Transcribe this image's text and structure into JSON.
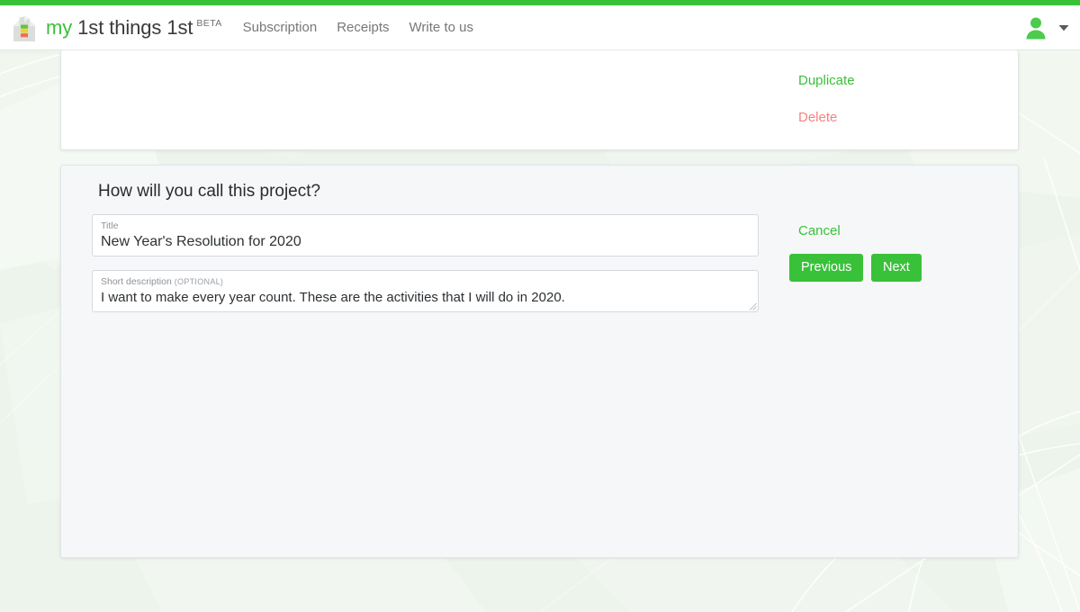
{
  "theme": {
    "brand_green": "#3ac13a",
    "delete_red": "#f8827f",
    "page_bg": "#ecf4ec",
    "card_white": "#ffffff",
    "card_gray": "#f6f7f9"
  },
  "header": {
    "logo_icon": "house-energy-logo-icon",
    "brand_my": "my",
    "brand_rest": "1st things 1st",
    "brand_beta": "BETA",
    "nav": [
      {
        "label": "Subscription",
        "name": "nav-subscription"
      },
      {
        "label": "Receipts",
        "name": "nav-receipts"
      },
      {
        "label": "Write to us",
        "name": "nav-write-to-us"
      }
    ],
    "account": {
      "avatar_icon": "user-avatar-icon",
      "caret_icon": "chevron-down-icon"
    }
  },
  "actions_card": {
    "duplicate_label": "Duplicate",
    "delete_label": "Delete"
  },
  "form_card": {
    "heading": "How will you call this project?",
    "title_field": {
      "label": "Title",
      "value": "New Year's Resolution for 2020",
      "placeholder": "Title"
    },
    "description_field": {
      "label": "Short description",
      "optional_tag": "(OPTIONAL)",
      "value": "I want to make every year count. These are the activities that I will do in 2020.",
      "placeholder": "Short description"
    },
    "cancel_label": "Cancel",
    "previous_label": "Previous",
    "next_label": "Next"
  }
}
